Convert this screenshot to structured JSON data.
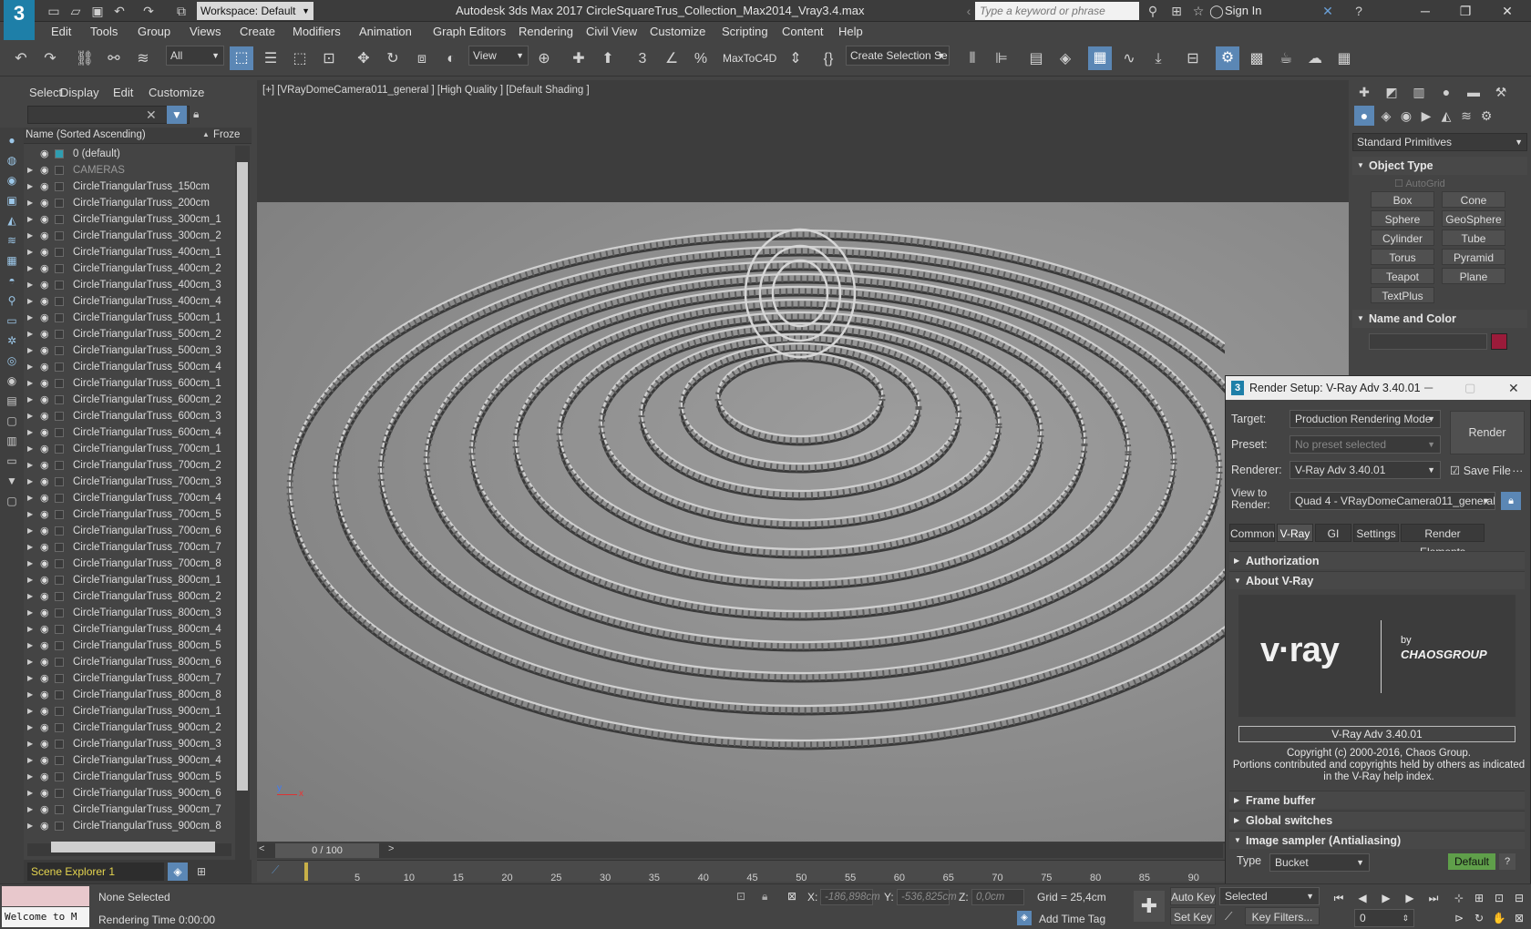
{
  "app": {
    "logo": "3",
    "title": "Autodesk 3ds Max 2017    CircleSquareTrus_Collection_Max2014_Vray3.4.max",
    "workspace": "Workspace: Default",
    "search_placeholder": "Type a keyword or phrase",
    "sign_in": "Sign In"
  },
  "menu": [
    "Edit",
    "Tools",
    "Group",
    "Views",
    "Create",
    "Modifiers",
    "Animation",
    "Graph Editors",
    "Rendering",
    "Civil View",
    "Customize",
    "Scripting",
    "Content",
    "Help"
  ],
  "toolbar": {
    "selection_filter": "All",
    "reference_coord": "View",
    "maxtoc4d": "MaxToC4D",
    "named_selection": "Create Selection Se"
  },
  "scene_explorer": {
    "menu": [
      "Select",
      "Display",
      "Edit",
      "Customize"
    ],
    "col_name": "Name (Sorted Ascending)",
    "col_frozen": "Froze",
    "rows": [
      {
        "name": "0 (default)",
        "dim": false
      },
      {
        "name": "CAMERAS",
        "dim": true
      },
      {
        "name": "CircleTriangularTruss_150cm",
        "dim": false
      },
      {
        "name": "CircleTriangularTruss_200cm",
        "dim": false
      },
      {
        "name": "CircleTriangularTruss_300cm_1",
        "dim": false
      },
      {
        "name": "CircleTriangularTruss_300cm_2",
        "dim": false
      },
      {
        "name": "CircleTriangularTruss_400cm_1",
        "dim": false
      },
      {
        "name": "CircleTriangularTruss_400cm_2",
        "dim": false
      },
      {
        "name": "CircleTriangularTruss_400cm_3",
        "dim": false
      },
      {
        "name": "CircleTriangularTruss_400cm_4",
        "dim": false
      },
      {
        "name": "CircleTriangularTruss_500cm_1",
        "dim": false
      },
      {
        "name": "CircleTriangularTruss_500cm_2",
        "dim": false
      },
      {
        "name": "CircleTriangularTruss_500cm_3",
        "dim": false
      },
      {
        "name": "CircleTriangularTruss_500cm_4",
        "dim": false
      },
      {
        "name": "CircleTriangularTruss_600cm_1",
        "dim": false
      },
      {
        "name": "CircleTriangularTruss_600cm_2",
        "dim": false
      },
      {
        "name": "CircleTriangularTruss_600cm_3",
        "dim": false
      },
      {
        "name": "CircleTriangularTruss_600cm_4",
        "dim": false
      },
      {
        "name": "CircleTriangularTruss_700cm_1",
        "dim": false
      },
      {
        "name": "CircleTriangularTruss_700cm_2",
        "dim": false
      },
      {
        "name": "CircleTriangularTruss_700cm_3",
        "dim": false
      },
      {
        "name": "CircleTriangularTruss_700cm_4",
        "dim": false
      },
      {
        "name": "CircleTriangularTruss_700cm_5",
        "dim": false
      },
      {
        "name": "CircleTriangularTruss_700cm_6",
        "dim": false
      },
      {
        "name": "CircleTriangularTruss_700cm_7",
        "dim": false
      },
      {
        "name": "CircleTriangularTruss_700cm_8",
        "dim": false
      },
      {
        "name": "CircleTriangularTruss_800cm_1",
        "dim": false
      },
      {
        "name": "CircleTriangularTruss_800cm_2",
        "dim": false
      },
      {
        "name": "CircleTriangularTruss_800cm_3",
        "dim": false
      },
      {
        "name": "CircleTriangularTruss_800cm_4",
        "dim": false
      },
      {
        "name": "CircleTriangularTruss_800cm_5",
        "dim": false
      },
      {
        "name": "CircleTriangularTruss_800cm_6",
        "dim": false
      },
      {
        "name": "CircleTriangularTruss_800cm_7",
        "dim": false
      },
      {
        "name": "CircleTriangularTruss_800cm_8",
        "dim": false
      },
      {
        "name": "CircleTriangularTruss_900cm_1",
        "dim": false
      },
      {
        "name": "CircleTriangularTruss_900cm_2",
        "dim": false
      },
      {
        "name": "CircleTriangularTruss_900cm_3",
        "dim": false
      },
      {
        "name": "CircleTriangularTruss_900cm_4",
        "dim": false
      },
      {
        "name": "CircleTriangularTruss_900cm_5",
        "dim": false
      },
      {
        "name": "CircleTriangularTruss_900cm_6",
        "dim": false
      },
      {
        "name": "CircleTriangularTruss_900cm_7",
        "dim": false
      },
      {
        "name": "CircleTriangularTruss_900cm_8",
        "dim": false
      }
    ],
    "footer": "Scene Explorer 1"
  },
  "viewport": {
    "label": "[+] [VRayDomeCamera011_general ] [High Quality ] [Default Shading ]",
    "axis_x": "x",
    "axis_y": "y"
  },
  "command_panel": {
    "category": "Standard Primitives",
    "object_type": "Object Type",
    "autogrid": "AutoGrid",
    "primitives": [
      "Box",
      "Cone",
      "Sphere",
      "GeoSphere",
      "Cylinder",
      "Tube",
      "Torus",
      "Pyramid",
      "Teapot",
      "Plane",
      "TextPlus"
    ],
    "name_and_color": "Name and Color",
    "object_color": "#9b1b3a"
  },
  "render_setup": {
    "title": "Render Setup: V-Ray Adv 3.40.01",
    "target_label": "Target:",
    "target": "Production Rendering Mode",
    "preset_label": "Preset:",
    "preset": "No preset selected",
    "renderer_label": "Renderer:",
    "renderer": "V-Ray Adv 3.40.01",
    "save_file": "Save File",
    "view_label": "View to Render:",
    "view": "Quad 4 - VRayDomeCamera011_general",
    "render_btn": "Render",
    "tabs": [
      "Common",
      "V-Ray",
      "GI",
      "Settings",
      "Render Elements"
    ],
    "active_tab": "V-Ray",
    "rollouts": [
      "Authorization",
      "About V-Ray"
    ],
    "logo_text": "v·ray",
    "logo_by": "by",
    "logo_company": "CHAOSGROUP",
    "version_text": "V-Ray Adv 3.40.01",
    "copyright": "Copyright (c) 2000-2016, Chaos Group.",
    "portions": "Portions contributed and copyrights held by others as indicated in the V-Ray help index.",
    "rollouts_below": [
      "Frame buffer",
      "Global switches",
      "Image sampler (Antialiasing)"
    ],
    "type_label": "Type",
    "type_value": "Bucket",
    "default_btn": "Default"
  },
  "timeline": {
    "position": "0 / 100",
    "ticks": [
      "5",
      "10",
      "15",
      "20",
      "25",
      "30",
      "35",
      "40",
      "45",
      "50",
      "55",
      "60",
      "65",
      "70",
      "75",
      "80",
      "85",
      "90"
    ]
  },
  "status": {
    "maxscript": "Welcome to M",
    "selection": "None Selected",
    "rendering_time": "Rendering Time  0:00:00",
    "x_label": "X:",
    "x_value": "-186,898cm",
    "y_label": "Y:",
    "y_value": "-536,825cm",
    "z_label": "Z:",
    "z_value": "0,0cm",
    "grid": "Grid = 25,4cm",
    "add_time_tag": "Add Time Tag",
    "auto_key": "Auto Key",
    "set_key": "Set Key",
    "key_mode": "Selected",
    "key_filters": "Key Filters...",
    "frame": "0"
  }
}
